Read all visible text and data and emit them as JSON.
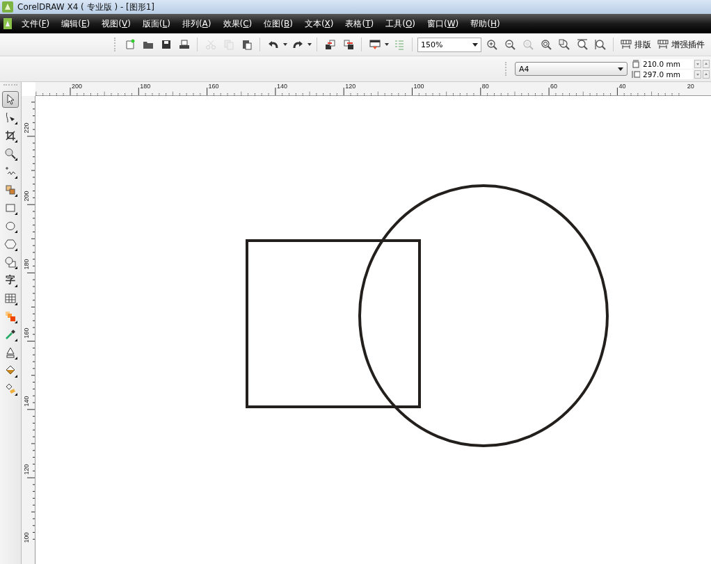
{
  "window": {
    "title": "CorelDRAW X4 ( 专业版 ) - [图形1]"
  },
  "menu": [
    "文件(F)",
    "编辑(E)",
    "视图(V)",
    "版面(L)",
    "排列(A)",
    "效果(C)",
    "位图(B)",
    "文本(X)",
    "表格(T)",
    "工具(O)",
    "窗口(W)",
    "帮助(H)"
  ],
  "toolbar": {
    "items": [
      {
        "kind": "new",
        "disabled": false
      },
      {
        "kind": "open",
        "disabled": false
      },
      {
        "kind": "save",
        "disabled": false
      },
      {
        "kind": "print",
        "disabled": false
      },
      {
        "kind": "sep"
      },
      {
        "kind": "cut",
        "disabled": true
      },
      {
        "kind": "copy",
        "disabled": true
      },
      {
        "kind": "paste",
        "disabled": false
      },
      {
        "kind": "sep"
      },
      {
        "kind": "undo",
        "disabled": false
      },
      {
        "kind": "caret"
      },
      {
        "kind": "redo",
        "disabled": false
      },
      {
        "kind": "caret"
      },
      {
        "kind": "sep"
      },
      {
        "kind": "import",
        "disabled": false
      },
      {
        "kind": "export",
        "disabled": false
      },
      {
        "kind": "sep"
      },
      {
        "kind": "launcher",
        "disabled": false
      },
      {
        "kind": "caret"
      },
      {
        "kind": "options",
        "disabled": false
      }
    ],
    "zoom": {
      "value": "150%"
    },
    "zoom_tools": [
      {
        "kind": "zoom-in",
        "disabled": false
      },
      {
        "kind": "zoom-out",
        "disabled": false
      },
      {
        "kind": "zoom-selected",
        "disabled": true
      },
      {
        "kind": "zoom-all",
        "disabled": false
      },
      {
        "kind": "zoom-page",
        "disabled": false
      },
      {
        "kind": "zoom-width",
        "disabled": false
      },
      {
        "kind": "zoom-height",
        "disabled": false
      }
    ],
    "buttons": [
      "排版",
      "增强插件"
    ]
  },
  "property_bar": {
    "page_size": "A4",
    "width": "210.0 mm",
    "height": "297.0 mm"
  },
  "toolbox": [
    {
      "kind": "pick",
      "selected": true
    },
    {
      "kind": "shape",
      "selected": false
    },
    {
      "kind": "crop",
      "selected": false
    },
    {
      "kind": "zoom",
      "selected": false
    },
    {
      "kind": "freehand",
      "selected": false
    },
    {
      "kind": "smart-fill",
      "selected": false
    },
    {
      "kind": "rectangle",
      "selected": false
    },
    {
      "kind": "ellipse",
      "selected": false
    },
    {
      "kind": "polygon",
      "selected": false
    },
    {
      "kind": "basic-shapes",
      "selected": false
    },
    {
      "kind": "text",
      "label": "字",
      "selected": false
    },
    {
      "kind": "table",
      "selected": false
    },
    {
      "kind": "blend",
      "selected": false
    },
    {
      "kind": "eyedropper",
      "selected": false
    },
    {
      "kind": "outline",
      "selected": false
    },
    {
      "kind": "fill",
      "selected": false
    },
    {
      "kind": "interactive-fill",
      "selected": false
    }
  ],
  "rulers": {
    "horizontal": [
      "200",
      "180",
      "160",
      "140",
      "120",
      "100",
      "80",
      "60",
      "40",
      "20"
    ],
    "vertical": [
      "220",
      "200",
      "180",
      "160",
      "140",
      "120",
      "100"
    ]
  },
  "canvas": {
    "shapes": [
      {
        "kind": "rectangle"
      },
      {
        "kind": "ellipse"
      }
    ]
  }
}
